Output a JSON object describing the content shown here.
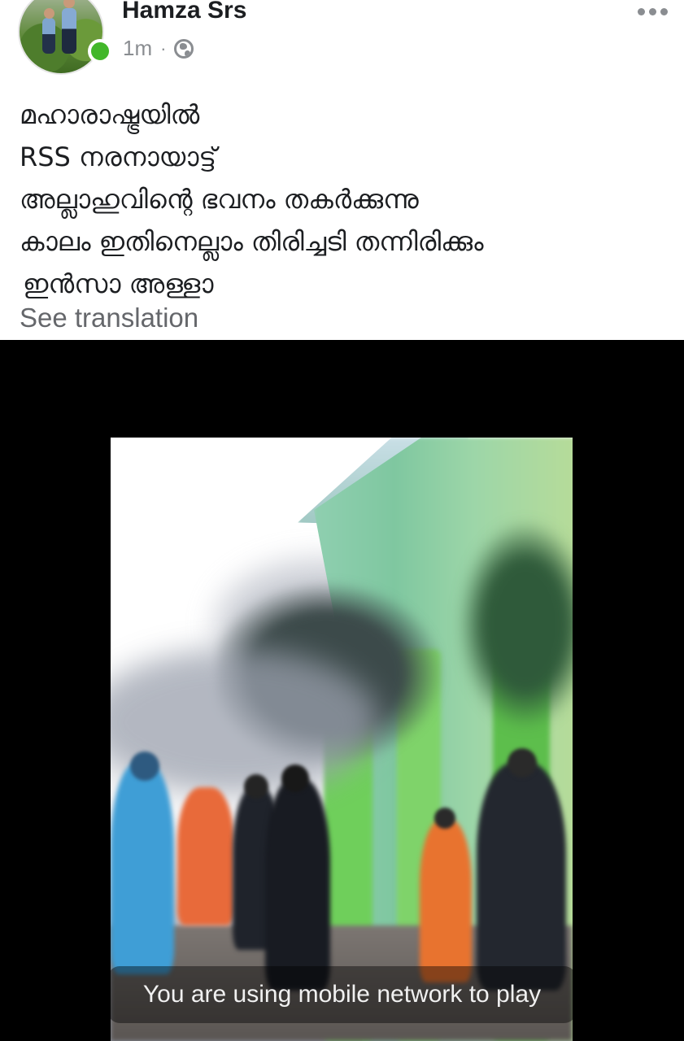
{
  "post": {
    "author": "Hamza Srs",
    "time": "1m",
    "separator": "·",
    "audience_icon": "globe-icon",
    "more_icon": "more-horizontal-icon",
    "text_lines": [
      "മഹാരാഷ്ട്രയിൽ",
      "RSS നരനായാട്ട്",
      "അല്ലാഹുവിന്റെ ഭവനം തകർക്കുന്നു",
      "കാലം ഇതിനെല്ലാം തിരിച്ചടി തന്നിരിക്കും",
      "ഇൻസാ അള്ളാ"
    ],
    "see_translation": "See translation"
  },
  "video": {
    "network_notice": "You are using mobile network to play"
  },
  "colors": {
    "online": "#42b72a",
    "text": "#1c1e21",
    "secondary": "#65676b",
    "video_bg": "#000000"
  }
}
